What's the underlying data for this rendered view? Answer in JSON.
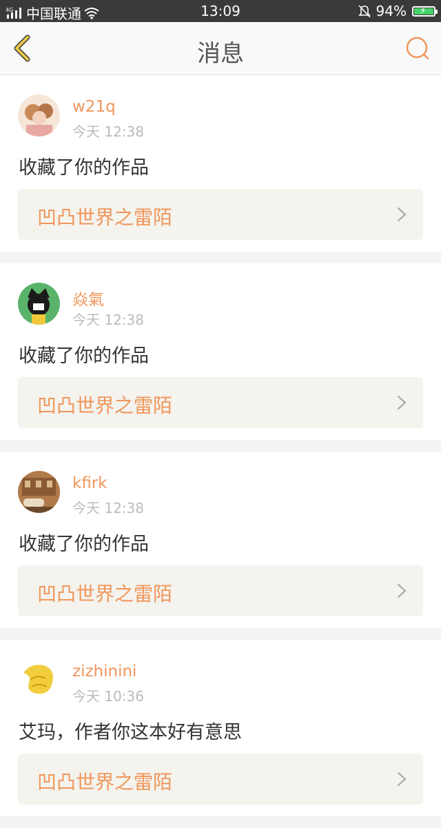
{
  "status": {
    "carrier": "中国联通",
    "signal_label": "4G",
    "time": "13:09",
    "battery": "94%",
    "battery_level": 0.94
  },
  "nav": {
    "title": "消息"
  },
  "messages": [
    {
      "username": "w21q",
      "time": "今天 12:38",
      "text": "收藏了你的作品",
      "work": "凹凸世界之雷陌"
    },
    {
      "username": "焱氣",
      "time": "今天 12:38",
      "text": "收藏了你的作品",
      "work": "凹凸世界之雷陌"
    },
    {
      "username": "kfirk",
      "time": "今天 12:38",
      "text": "收藏了你的作品",
      "work": "凹凸世界之雷陌"
    },
    {
      "username": "zizhinini",
      "time": "今天 10:36",
      "text": "艾玛，作者你这本好有意思",
      "work": "凹凸世界之雷陌"
    }
  ],
  "colors": {
    "accent": "#f0965a",
    "back_icon": "#e8c84a"
  }
}
